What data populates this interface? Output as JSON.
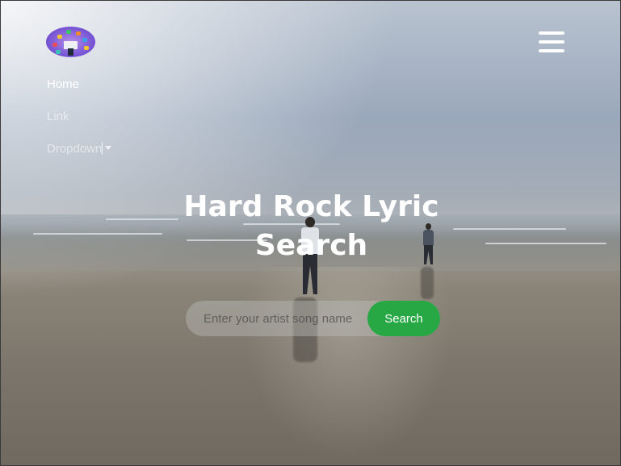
{
  "brand": {
    "logo_icon": "globe-computer-logo-icon"
  },
  "navbar": {
    "toggler_icon": "hamburger-menu-icon",
    "links": [
      {
        "label": "Home"
      },
      {
        "label": "Link"
      },
      {
        "label": "Dropdown"
      }
    ]
  },
  "hero": {
    "title_line1": "Hard Rock Lyric",
    "title_line2": "Search"
  },
  "search": {
    "placeholder": "Enter your artist song name",
    "button_label": "Search"
  },
  "colors": {
    "search_button": "#28a745",
    "logo": "#7b58d6"
  }
}
